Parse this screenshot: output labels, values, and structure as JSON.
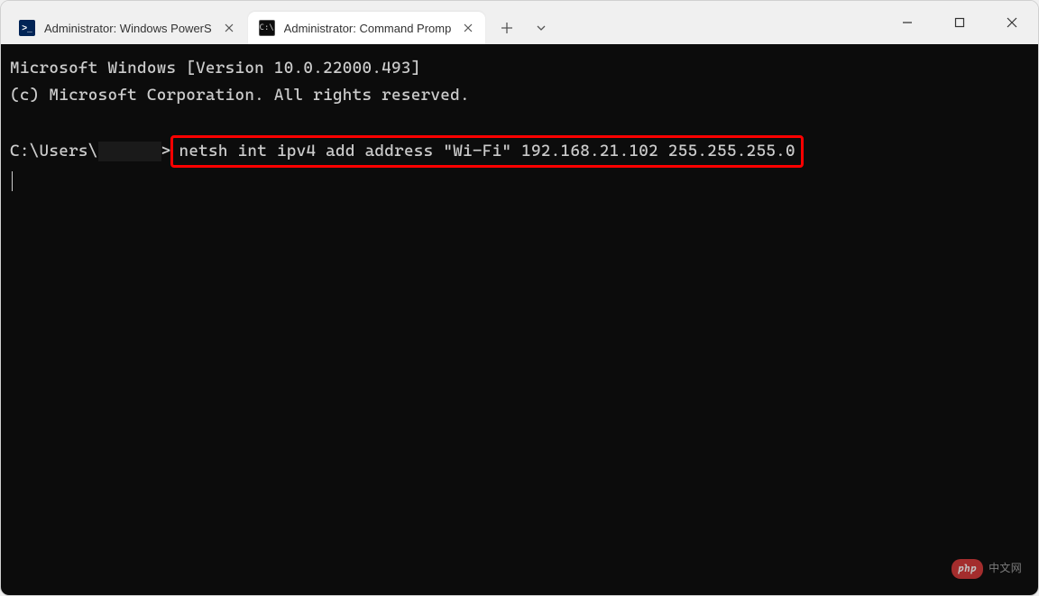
{
  "tabs": [
    {
      "title": "Administrator: Windows PowerS",
      "icon_text": ">_",
      "active": false
    },
    {
      "title": "Administrator: Command Promp",
      "icon_text": "C:\\",
      "active": true
    }
  ],
  "window_controls": {
    "new_tab": "+",
    "dropdown": "⌄",
    "minimize": "—",
    "maximize": "▢",
    "close": "✕"
  },
  "terminal": {
    "line1": "Microsoft Windows [Version 10.0.22000.493]",
    "line2": "(c) Microsoft Corporation. All rights reserved.",
    "prompt_prefix": "C:\\Users\\",
    "prompt_suffix": ">",
    "command": "netsh int ipv4 add address \"Wi-Fi\" 192.168.21.102 255.255.255.0"
  },
  "watermark": {
    "badge": "php",
    "text": "中文网"
  }
}
